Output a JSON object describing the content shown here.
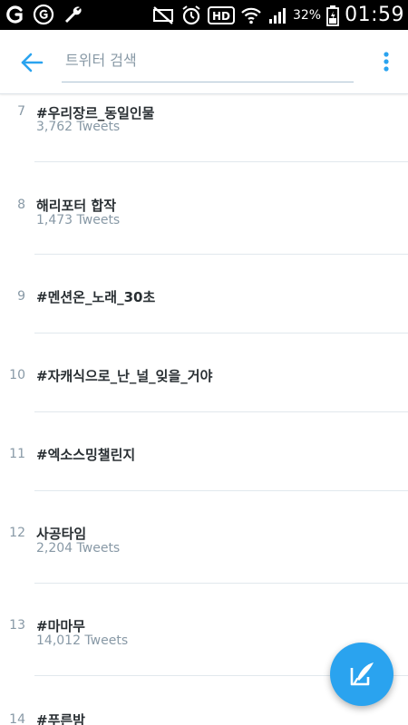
{
  "status_bar": {
    "battery_percent": "32%",
    "time": "01:59",
    "icons": [
      "carrier-icon",
      "g-circle-icon",
      "wrench-icon",
      "mute-icon",
      "alarm-icon",
      "hd-icon",
      "wifi-icon",
      "signal-icon",
      "battery-icon"
    ]
  },
  "app_bar": {
    "search_placeholder": "트위터 검색",
    "back_icon": "back-arrow-icon",
    "overflow_icon": "more-vertical-icon",
    "accent_color": "#2aa3ef"
  },
  "trends": [
    {
      "rank": "7",
      "topic": "#우리장르_동일인물",
      "count": "3,762 Tweets"
    },
    {
      "rank": "8",
      "topic": "해리포터 합작",
      "count": "1,473 Tweets"
    },
    {
      "rank": "9",
      "topic": "#멘션온_노래_30초",
      "count": ""
    },
    {
      "rank": "10",
      "topic": "#자캐식으로_난_널_잊을_거야",
      "count": ""
    },
    {
      "rank": "11",
      "topic": "#엑소스밍챌린지",
      "count": ""
    },
    {
      "rank": "12",
      "topic": "사공타임",
      "count": "2,204 Tweets"
    },
    {
      "rank": "13",
      "topic": "#마마무",
      "count": "14,012 Tweets"
    },
    {
      "rank": "14",
      "topic": "#푸른밤",
      "count": ""
    }
  ],
  "fab": {
    "icon": "compose-tweet-icon",
    "color": "#2aa3ef"
  }
}
